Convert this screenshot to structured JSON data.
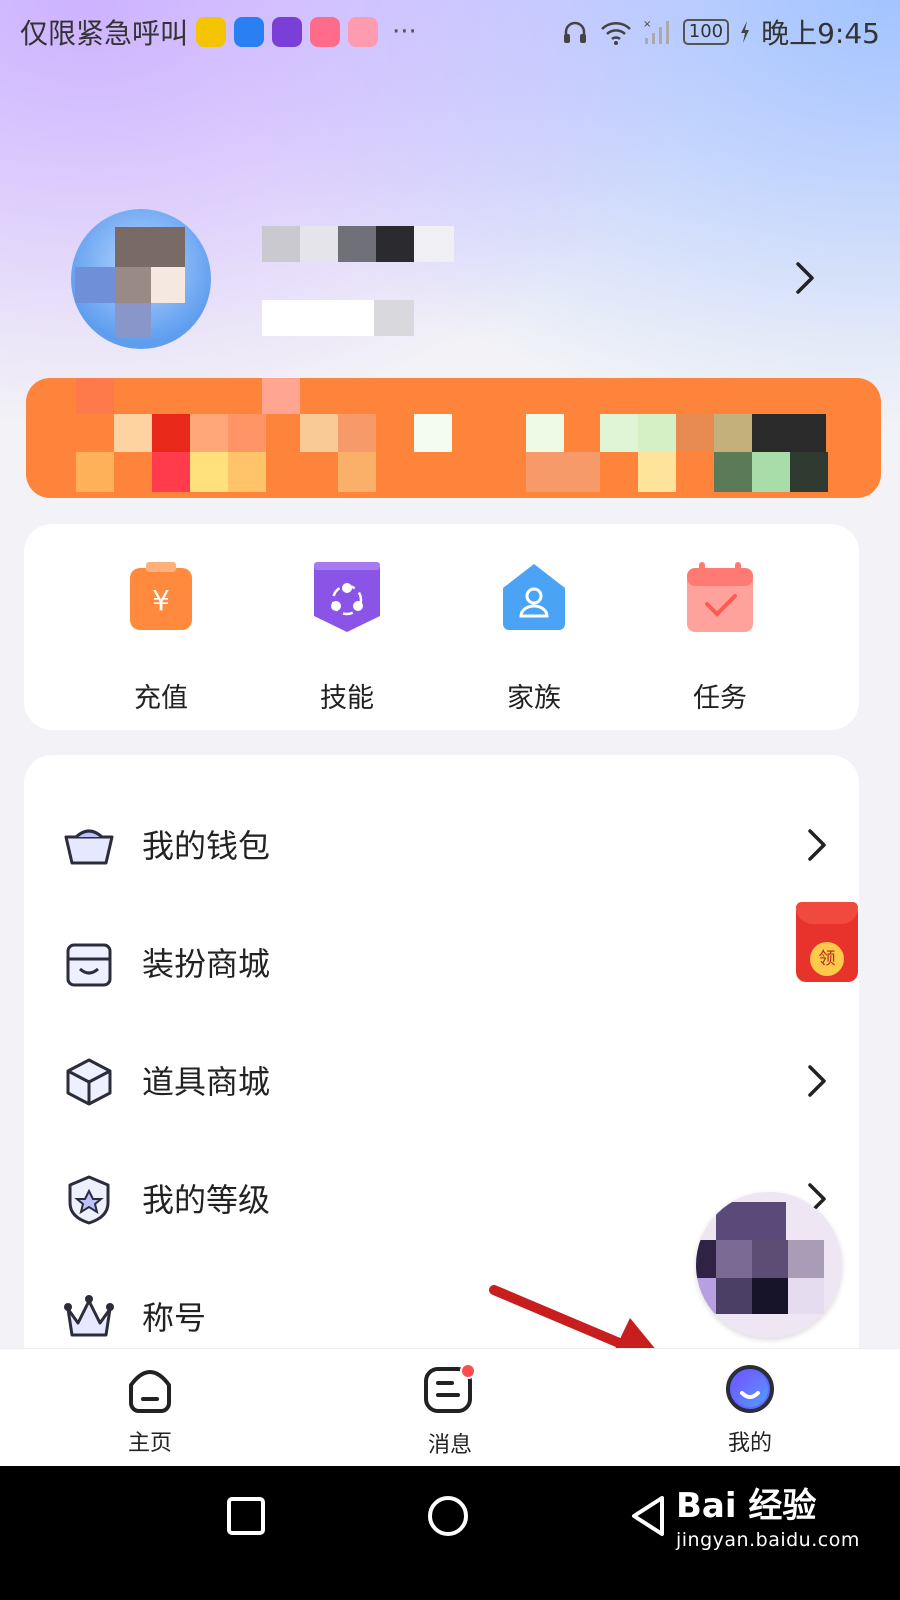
{
  "status_bar": {
    "carrier": "仅限紧急呼叫",
    "battery": "100",
    "time": "晚上9:45"
  },
  "profile": {
    "chevron_icon": "chevron-right-icon"
  },
  "quick_actions": [
    {
      "label": "充值",
      "icon": "recharge-icon",
      "color": "#ff8a3d"
    },
    {
      "label": "技能",
      "icon": "skill-icon",
      "color": "#8a55e6"
    },
    {
      "label": "家族",
      "icon": "family-icon",
      "color": "#4aa3f5"
    },
    {
      "label": "任务",
      "icon": "task-icon",
      "color": "#ff7a72"
    }
  ],
  "menu": [
    {
      "label": "我的钱包",
      "icon": "wallet-icon"
    },
    {
      "label": "装扮商城",
      "icon": "dressup-store-icon"
    },
    {
      "label": "道具商城",
      "icon": "props-store-icon"
    },
    {
      "label": "我的等级",
      "icon": "level-icon"
    },
    {
      "label": "称号",
      "icon": "crown-icon"
    }
  ],
  "red_envelope": {
    "label": "领"
  },
  "bottom_nav": [
    {
      "label": "主页",
      "icon": "home-icon"
    },
    {
      "label": "消息",
      "icon": "message-icon"
    },
    {
      "label": "我的",
      "icon": "me-icon"
    }
  ],
  "watermark": {
    "brand": "Bai 经验",
    "url": "jingyan.baidu.com"
  },
  "colors": {
    "accent": "#4f6bff",
    "banner": "#ff843b",
    "arrow": "#c81e1e"
  }
}
